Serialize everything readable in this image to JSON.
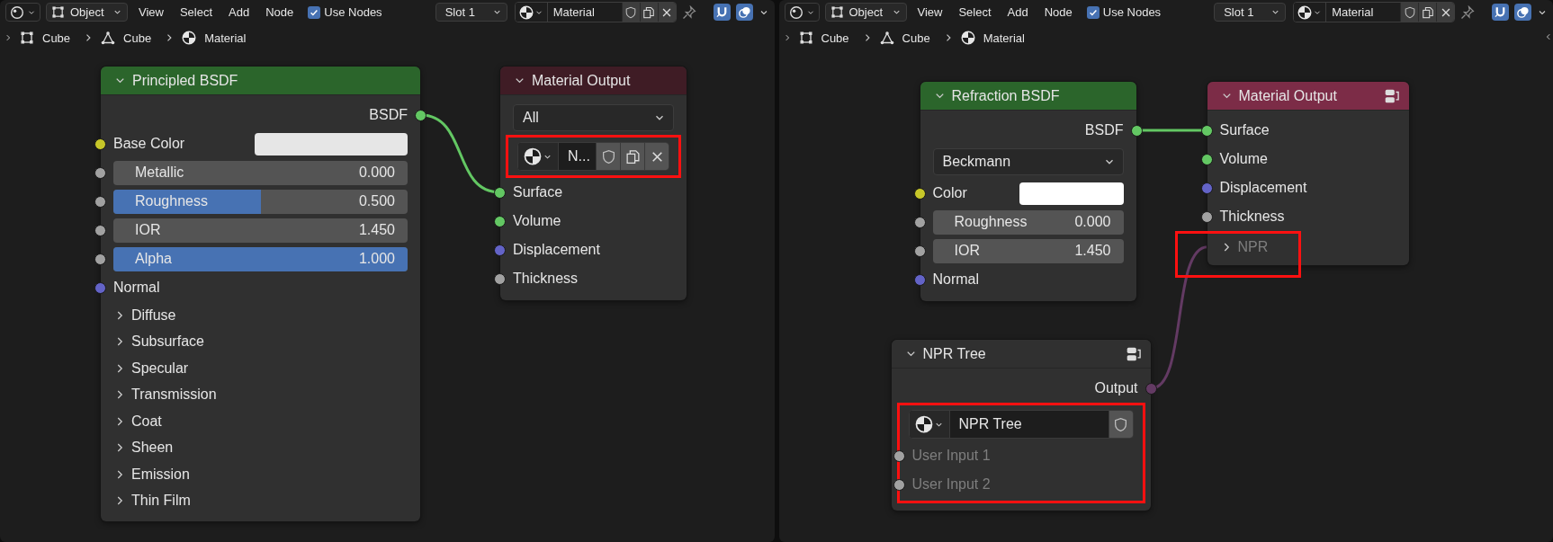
{
  "editors": [
    {
      "header": {
        "mode": "Object",
        "menus": [
          "View",
          "Select",
          "Add",
          "Node"
        ],
        "use_nodes": {
          "label": "Use Nodes",
          "checked": true
        },
        "slot": "Slot 1",
        "material": "Material",
        "toggles": [
          {
            "kind": "snap",
            "on": true
          },
          {
            "kind": "overlay",
            "on": true
          }
        ]
      },
      "breadcrumbs": [
        {
          "kind": "object",
          "label": "Cube"
        },
        {
          "kind": "mesh",
          "label": "Cube"
        },
        {
          "kind": "material",
          "label": "Material"
        }
      ],
      "nodes": [
        {
          "title": "Principled BSDF",
          "color": "#2b652b",
          "expanded": true,
          "header_icon": false,
          "rows": [
            {
              "kind": "output",
              "label": "BSDF",
              "color": "#63c763",
              "connected": true
            },
            {
              "kind": "color",
              "label": "Base Color",
              "color": "#c7c729",
              "value": {
                "color": "#e6e6e6"
              }
            },
            {
              "kind": "slider",
              "label": "Metallic",
              "value": "0.000",
              "level": 0,
              "color": "#a1a1a1"
            },
            {
              "kind": "slider",
              "label": "Roughness",
              "value": "0.500",
              "level": 0.5,
              "color": "#a1a1a1"
            },
            {
              "kind": "number",
              "label": "IOR",
              "value": "1.450",
              "color": "#a1a1a1"
            },
            {
              "kind": "slider",
              "label": "Alpha",
              "value": "1.000",
              "level": 1,
              "color": "#a1a1a1"
            },
            {
              "kind": "input",
              "label": "Normal",
              "color": "#6363c7",
              "disabled": false
            },
            {
              "kind": "panel",
              "label": "Diffuse",
              "expanded": false,
              "disabled": false
            },
            {
              "kind": "panel",
              "label": "Subsurface",
              "expanded": false,
              "disabled": false
            },
            {
              "kind": "panel",
              "label": "Specular",
              "expanded": false,
              "disabled": false
            },
            {
              "kind": "panel",
              "label": "Transmission",
              "expanded": false,
              "disabled": false
            },
            {
              "kind": "panel",
              "label": "Coat",
              "expanded": false,
              "disabled": false
            },
            {
              "kind": "panel",
              "label": "Sheen",
              "expanded": false,
              "disabled": false
            },
            {
              "kind": "panel",
              "label": "Emission",
              "expanded": false,
              "disabled": false
            },
            {
              "kind": "panel",
              "label": "Thin Film",
              "expanded": false,
              "disabled": false
            }
          ]
        },
        {
          "title": "Material Output",
          "color": "#3f1c25",
          "expanded": true,
          "header_icon": false,
          "rows": [
            {
              "kind": "dropdown",
              "value": "All"
            },
            {
              "kind": "datablock",
              "name": "N...",
              "highlighted": true,
              "buttons": [
                {
                  "kind": "shield"
                },
                {
                  "kind": "copy"
                },
                {
                  "kind": "close"
                }
              ]
            },
            {
              "kind": "input",
              "label": "Surface",
              "color": "#63c763",
              "disabled": false,
              "connected": true
            },
            {
              "kind": "input",
              "label": "Volume",
              "color": "#63c763",
              "disabled": false
            },
            {
              "kind": "input",
              "label": "Displacement",
              "color": "#6363c7",
              "disabled": false
            },
            {
              "kind": "input",
              "label": "Thickness",
              "color": "#a1a1a1",
              "disabled": false
            }
          ]
        }
      ]
    },
    {
      "header": {
        "mode": "Object",
        "menus": [
          "View",
          "Select",
          "Add",
          "Node"
        ],
        "use_nodes": {
          "label": "Use Nodes",
          "checked": true
        },
        "slot": "Slot 1",
        "material": "Material",
        "toggles": [
          {
            "kind": "snap",
            "on": true
          },
          {
            "kind": "overlay",
            "on": true
          }
        ]
      },
      "breadcrumbs": [
        {
          "kind": "object",
          "label": "Cube"
        },
        {
          "kind": "mesh",
          "label": "Cube"
        },
        {
          "kind": "material",
          "label": "Material"
        }
      ],
      "nodes": [
        {
          "title": "Refraction BSDF",
          "color": "#2b652b",
          "expanded": true,
          "header_icon": false,
          "rows": [
            {
              "kind": "output",
              "label": "BSDF",
              "color": "#63c763",
              "connected": true
            },
            {
              "kind": "dropdown",
              "value": "Beckmann"
            },
            {
              "kind": "color",
              "label": "Color",
              "color": "#c7c729",
              "value": {
                "color": "#ffffff"
              }
            },
            {
              "kind": "number",
              "label": "Roughness",
              "value": "0.000",
              "color": "#a1a1a1"
            },
            {
              "kind": "number",
              "label": "IOR",
              "value": "1.450",
              "color": "#a1a1a1"
            },
            {
              "kind": "input",
              "label": "Normal",
              "color": "#6363c7",
              "disabled": false
            }
          ]
        },
        {
          "title": "Material Output",
          "color": "#7c2c47",
          "expanded": true,
          "header_icon": true,
          "rows": [
            {
              "kind": "input",
              "label": "Surface",
              "color": "#63c763",
              "disabled": false,
              "connected": true
            },
            {
              "kind": "input",
              "label": "Volume",
              "color": "#63c763",
              "disabled": false
            },
            {
              "kind": "input",
              "label": "Displacement",
              "color": "#6363c7",
              "disabled": false
            },
            {
              "kind": "input",
              "label": "Thickness",
              "color": "#a1a1a1",
              "disabled": false
            },
            {
              "kind": "panel",
              "label": "NPR",
              "expanded": false,
              "disabled": true,
              "highlighted": true,
              "connected": true
            }
          ]
        },
        {
          "title": "NPR Tree",
          "color": "#303030",
          "expanded": true,
          "header_icon": true,
          "rows": [
            {
              "kind": "output",
              "label": "Output",
              "color": "#633a63",
              "connected": true
            },
            {
              "kind": "datablock",
              "name": "NPR Tree",
              "highlighted": true,
              "buttons": [
                {
                  "kind": "shield"
                }
              ]
            },
            {
              "kind": "input",
              "label": "User Input 1",
              "color": "#a1a1a1",
              "disabled": true,
              "highlighted": true
            },
            {
              "kind": "input",
              "label": "User Input 2",
              "color": "#a1a1a1",
              "disabled": true,
              "highlighted": true
            }
          ]
        }
      ]
    }
  ]
}
